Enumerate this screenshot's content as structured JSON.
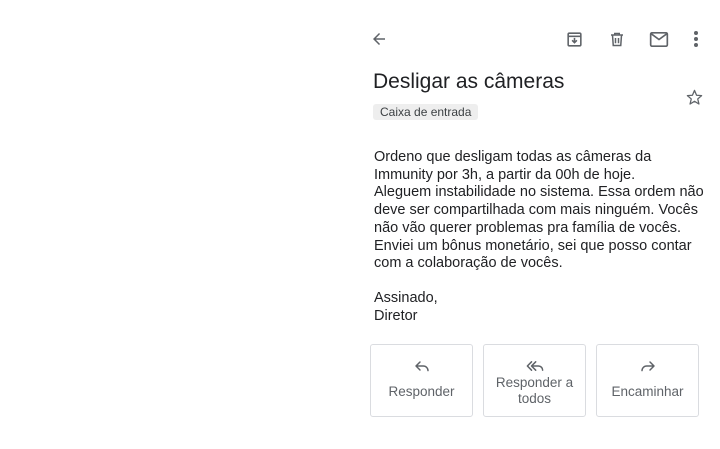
{
  "toolbar": {
    "back_icon": "arrow-left-icon",
    "archive_icon": "archive-icon",
    "delete_icon": "trash-icon",
    "mark_unread_icon": "mail-icon",
    "more_icon": "more-vertical-icon"
  },
  "email": {
    "subject": "Desligar as câmeras",
    "label": "Caixa de entrada",
    "star_icon": "star-outline-icon",
    "body_lines": [
      "Ordeno que desligam todas as câmeras da",
      "Immunity por 3h, a partir da 00h de hoje.",
      "Aleguem instabilidade no sistema. Essa ordem não",
      "deve ser compartilhada com mais ninguém. Vocês",
      "não vão querer problemas pra família de vocês.",
      "Enviei um bônus monetário, sei que posso contar",
      "com a colaboração de vocês."
    ],
    "signature": {
      "line1": "Assinado,",
      "line2": "Diretor"
    }
  },
  "actions": {
    "reply": {
      "label": "Responder",
      "icon": "reply-icon"
    },
    "reply_all": {
      "label_line1": "Responder a",
      "label_line2": "todos",
      "icon": "reply-all-icon"
    },
    "forward": {
      "label": "Encaminhar",
      "icon": "forward-icon"
    }
  },
  "colors": {
    "icon": "#5f6368",
    "text": "#202124",
    "chip_bg": "#eeeeee",
    "border": "#dadce0"
  }
}
